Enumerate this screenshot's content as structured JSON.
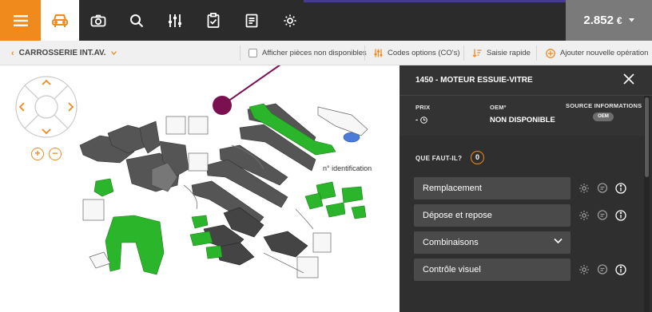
{
  "topbar": {
    "menu_icon": "hamburger-icon",
    "nav": [
      {
        "icon": "car-icon",
        "active": true
      },
      {
        "icon": "camera-icon",
        "active": false
      },
      {
        "icon": "search-icon",
        "active": false
      },
      {
        "icon": "sliders-icon",
        "active": false
      },
      {
        "icon": "clipboard-check-icon",
        "active": false
      },
      {
        "icon": "document-list-icon",
        "active": false
      },
      {
        "icon": "gear-icon",
        "active": false
      }
    ],
    "price_main": "2.852",
    "price_currency": "€",
    "accent_color": "#f08a1d"
  },
  "subbar": {
    "section_label": "CARROSSERIE INT.AV.",
    "show_unavailable_label": "Afficher pièces non disponibles",
    "option_codes_label": "Codes options (CO's)",
    "quick_entry_label": "Saisie rapide",
    "add_operation_label": "Ajouter nouvelle opération"
  },
  "diagram": {
    "annotation": "n° identification",
    "part_color": "#2bb52b",
    "part_color_grey": "#555555",
    "marker_color": "#7b1050"
  },
  "panel": {
    "title": "1450 - MOTEUR ESSUIE-VITRE",
    "price_label": "PRIX",
    "price_value": "-",
    "oem_label": "OEMº",
    "oem_value": "NON DISPONIBLE",
    "source_label": "SOURCE INFORMATIONS",
    "source_badge": "OEM",
    "question_label": "QUE FAUT-IL?",
    "question_count": "0",
    "operations": [
      {
        "label": "Remplacement",
        "has_icons": true
      },
      {
        "label": "Dépose et repose",
        "has_icons": true
      },
      {
        "label": "Combinaisons",
        "has_icons": false,
        "dropdown": true
      },
      {
        "label": "Contrôle visuel",
        "has_icons": true
      }
    ]
  }
}
